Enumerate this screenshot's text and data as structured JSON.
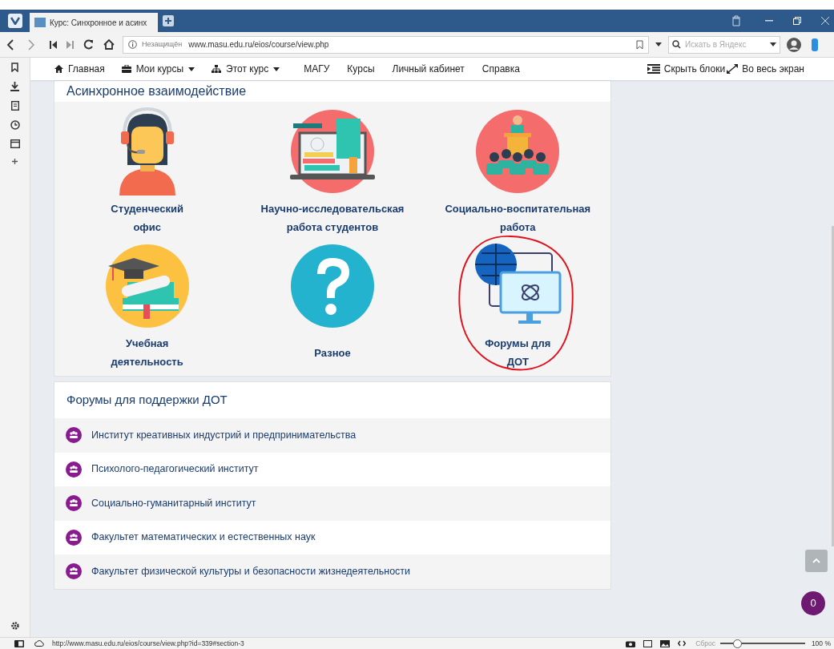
{
  "browser": {
    "tab_title": "Курс: Синхронное и асинх",
    "security": "Незащищён",
    "url": "www.masu.edu.ru/eios/course/view.php",
    "search_placeholder": "Искать в Яндекс"
  },
  "nav": {
    "items": [
      {
        "label": "Главная",
        "dropdown": false
      },
      {
        "label": "Мои курсы",
        "dropdown": true
      },
      {
        "label": "Этот курс",
        "dropdown": true
      },
      {
        "label": "МАГУ",
        "dropdown": false
      },
      {
        "label": "Курсы",
        "dropdown": false
      },
      {
        "label": "Личный кабинет",
        "dropdown": false
      },
      {
        "label": "Справка",
        "dropdown": false
      }
    ],
    "hide_blocks": "Скрыть блоки",
    "fullscreen": "Во весь экран"
  },
  "section": {
    "title": "Асинхронное взаимодействие",
    "tiles": [
      {
        "label": "Студенческий офис",
        "circled": false
      },
      {
        "label": "Научно-исследовательская работа студентов",
        "circled": false
      },
      {
        "label": "Социально-воспитательная работа",
        "circled": false
      },
      {
        "label": "Учебная деятельность",
        "circled": false
      },
      {
        "label": "Разное",
        "circled": false
      },
      {
        "label": "Форумы для ДОТ",
        "circled": true
      }
    ]
  },
  "forums": {
    "title": "Форумы для поддержки ДОТ",
    "items": [
      "Институт креативных индустрий и предпринимательства",
      "Психолого-педагогический институт",
      "Социально-гуманитарный институт",
      "Факультет математических и естественных наук",
      "Факультет физической культуры и безопасности жизнедеятельности"
    ]
  },
  "chat_badge": "0",
  "status_bar": {
    "url": "http://www.masu.edu.ru/eios/course/view.php?id=339#section-3",
    "reset": "Сброс",
    "zoom": "100 %",
    "zoom_level": {
      "level": 0.17
    }
  }
}
